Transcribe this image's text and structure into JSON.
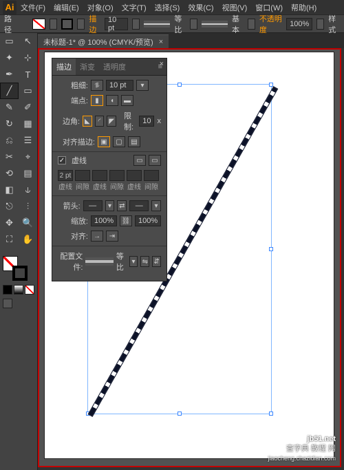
{
  "app_icon": "Ai",
  "menus": [
    "文件(F)",
    "编辑(E)",
    "对象(O)",
    "文字(T)",
    "选择(S)",
    "效果(C)",
    "视图(V)",
    "窗口(W)",
    "帮助(H)"
  ],
  "options_bar": {
    "label_path": "路径",
    "stroke_btn": "描边",
    "weight": "10 pt",
    "uniform": "等比",
    "basic": "基本",
    "opacity_label": "不透明度",
    "opacity_val": "100%",
    "style_label": "样式"
  },
  "doc_tab": {
    "title": "未标题-1* @ 100% (CMYK/预览)"
  },
  "panel": {
    "tabs": [
      "描边",
      "渐变",
      "透明度"
    ],
    "weight_label": "粗细:",
    "weight_value": "10 pt",
    "cap_label": "端点:",
    "corner_label": "边角:",
    "limit_label": "限制:",
    "limit_value": "10",
    "limit_suffix": "x",
    "align_label": "对齐描边:",
    "dashed_label": "虚线",
    "dash_slots": [
      "2 pt",
      "",
      "",
      "",
      "",
      ""
    ],
    "dash_lbls": [
      "虚线",
      "间隙",
      "虚线",
      "间隙",
      "虚线",
      "间隙"
    ],
    "arrow_label": "箭头:",
    "scale_label": "缩放:",
    "scale_a": "100%",
    "scale_b": "100%",
    "alignarrow_label": "对齐:",
    "profile_label": "配置文件:",
    "profile_val": "等比"
  },
  "tools_grid": [
    [
      "▭",
      "↖"
    ],
    [
      "✦",
      "⊹"
    ],
    [
      "⌇",
      "T"
    ],
    [
      "╱",
      "▭"
    ],
    [
      "✎",
      "✐"
    ],
    [
      "↻",
      "▦"
    ],
    [
      "⎌",
      "☰"
    ],
    [
      "✂",
      "⌖"
    ],
    [
      "⟲",
      "▤"
    ],
    [
      "◧",
      "⫝"
    ],
    [
      "⎋",
      "⫶"
    ],
    [
      "✥",
      "🔍"
    ],
    [
      "⛶",
      "✋"
    ]
  ],
  "mini_swatches": [
    "#000",
    "#fff",
    "#f00"
  ],
  "watermark": {
    "l1": "查字典 教程 网",
    "l2": "jiaocheng.chazidian.com",
    "badge": "jb51.net"
  }
}
